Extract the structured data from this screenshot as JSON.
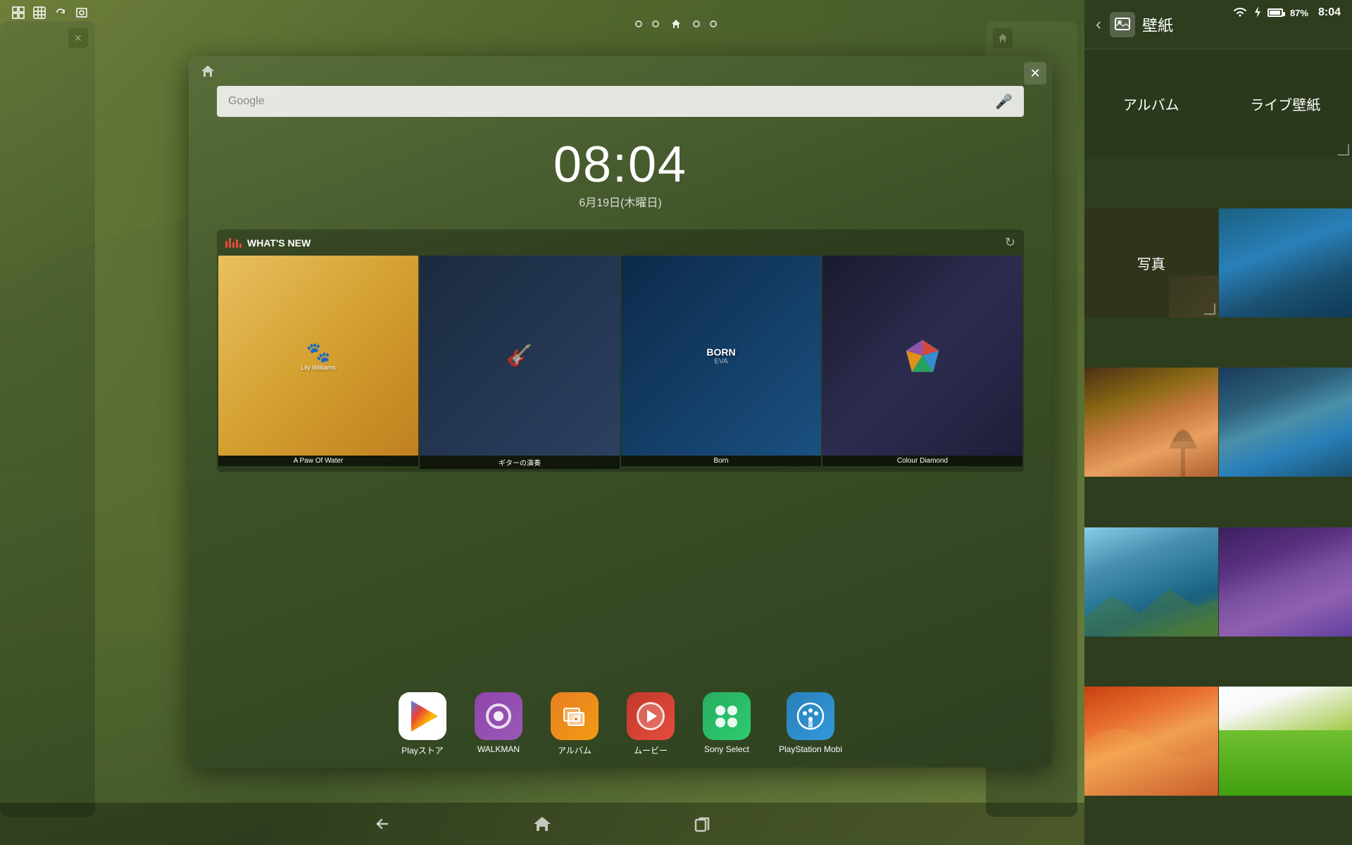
{
  "statusBar": {
    "time": "8:04",
    "battery": "87%",
    "batteryIcon": "battery-icon",
    "wifiIcon": "wifi-icon",
    "chargeIcon": "charge-icon",
    "leftIcons": [
      "window-icon",
      "grid-icon",
      "rotate-icon",
      "screenshot-icon"
    ]
  },
  "dotNav": {
    "dots": [
      "dot1",
      "dot2",
      "home",
      "dot4",
      "dot5"
    ]
  },
  "mainPanel": {
    "closeButton": "✕",
    "searchPlaceholder": "Google",
    "clock": "08:04",
    "date": "6月19日(木曜日)",
    "whatsNew": {
      "title": "WHAT'S NEW",
      "refreshIcon": "refresh-icon",
      "items": [
        {
          "id": "paw",
          "label": "A Paw Of Water",
          "artist": "Lily Williams",
          "theme": "paw"
        },
        {
          "id": "guitar",
          "label": "ギターの演奏",
          "theme": "guitar"
        },
        {
          "id": "born",
          "label": "Born",
          "theme": "born"
        },
        {
          "id": "diamond",
          "label": "Colour Diamond",
          "theme": "diamond"
        }
      ]
    },
    "appDock": [
      {
        "id": "play",
        "label": "Playストア",
        "iconClass": "icon-play",
        "theme": "play"
      },
      {
        "id": "walkman",
        "label": "WALKMAN",
        "iconClass": "icon-walkman",
        "theme": "walkman"
      },
      {
        "id": "album",
        "label": "アルバム",
        "iconClass": "icon-album",
        "theme": "album"
      },
      {
        "id": "movie",
        "label": "ムービー",
        "iconClass": "icon-movie",
        "theme": "movie"
      },
      {
        "id": "sony",
        "label": "Sony Select",
        "iconClass": "icon-sony",
        "theme": "sony"
      },
      {
        "id": "ps",
        "label": "PlayStation Mobi",
        "iconClass": "icon-ps",
        "theme": "ps"
      }
    ]
  },
  "wallpaperPanel": {
    "title": "壁紙",
    "backIcon": "back-icon",
    "wallpaperIcon": "wallpaper-icon",
    "options": [
      {
        "id": "album",
        "label": "アルバム",
        "type": "text-only"
      },
      {
        "id": "live",
        "label": "ライブ壁紙",
        "type": "text-only"
      },
      {
        "id": "photos",
        "label": "写真",
        "type": "text-only"
      },
      {
        "id": "blue-water",
        "label": "",
        "type": "thumb-blue"
      },
      {
        "id": "sunset",
        "label": "",
        "type": "thumb-sunset"
      },
      {
        "id": "coastal",
        "label": "",
        "type": "thumb-coastal"
      },
      {
        "id": "mountain",
        "label": "",
        "type": "thumb-mountain"
      },
      {
        "id": "purple",
        "label": "",
        "type": "thumb-purple"
      },
      {
        "id": "orange",
        "label": "",
        "type": "thumb-orange"
      },
      {
        "id": "grass",
        "label": "",
        "type": "thumb-grass"
      }
    ]
  },
  "bottomNav": {
    "backButton": "back-button",
    "homeButton": "home-button",
    "recentButton": "recent-button"
  }
}
